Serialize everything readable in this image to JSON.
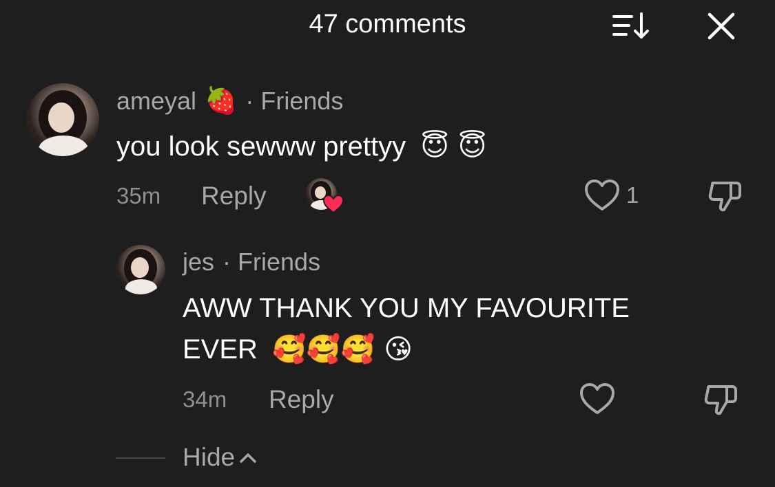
{
  "header": {
    "title": "47 comments",
    "sort_icon": "sort-descending-icon",
    "close_icon": "close-icon"
  },
  "comments": [
    {
      "username": "ameyal",
      "badge_emoji": "🍓",
      "relation": "Friends",
      "text": "you look sewww prettyy",
      "emojis": "😇 😇",
      "time": "35m",
      "reply_label": "Reply",
      "like_count": "1",
      "liked_by_creator_icon": "creator-heart-icon"
    },
    {
      "username": "jes",
      "relation": "Friends",
      "text_line1": "AWW THANK YOU MY FAVOURITE",
      "text_line2": "EVER",
      "emojis": "🥰🥰🥰 😘",
      "time": "34m",
      "reply_label": "Reply"
    }
  ],
  "hide_label": "Hide",
  "colors": {
    "background": "#1e1e1e",
    "text_primary": "#ffffff",
    "text_secondary": "#a8a8a8",
    "heart_red": "#fe2c55"
  }
}
